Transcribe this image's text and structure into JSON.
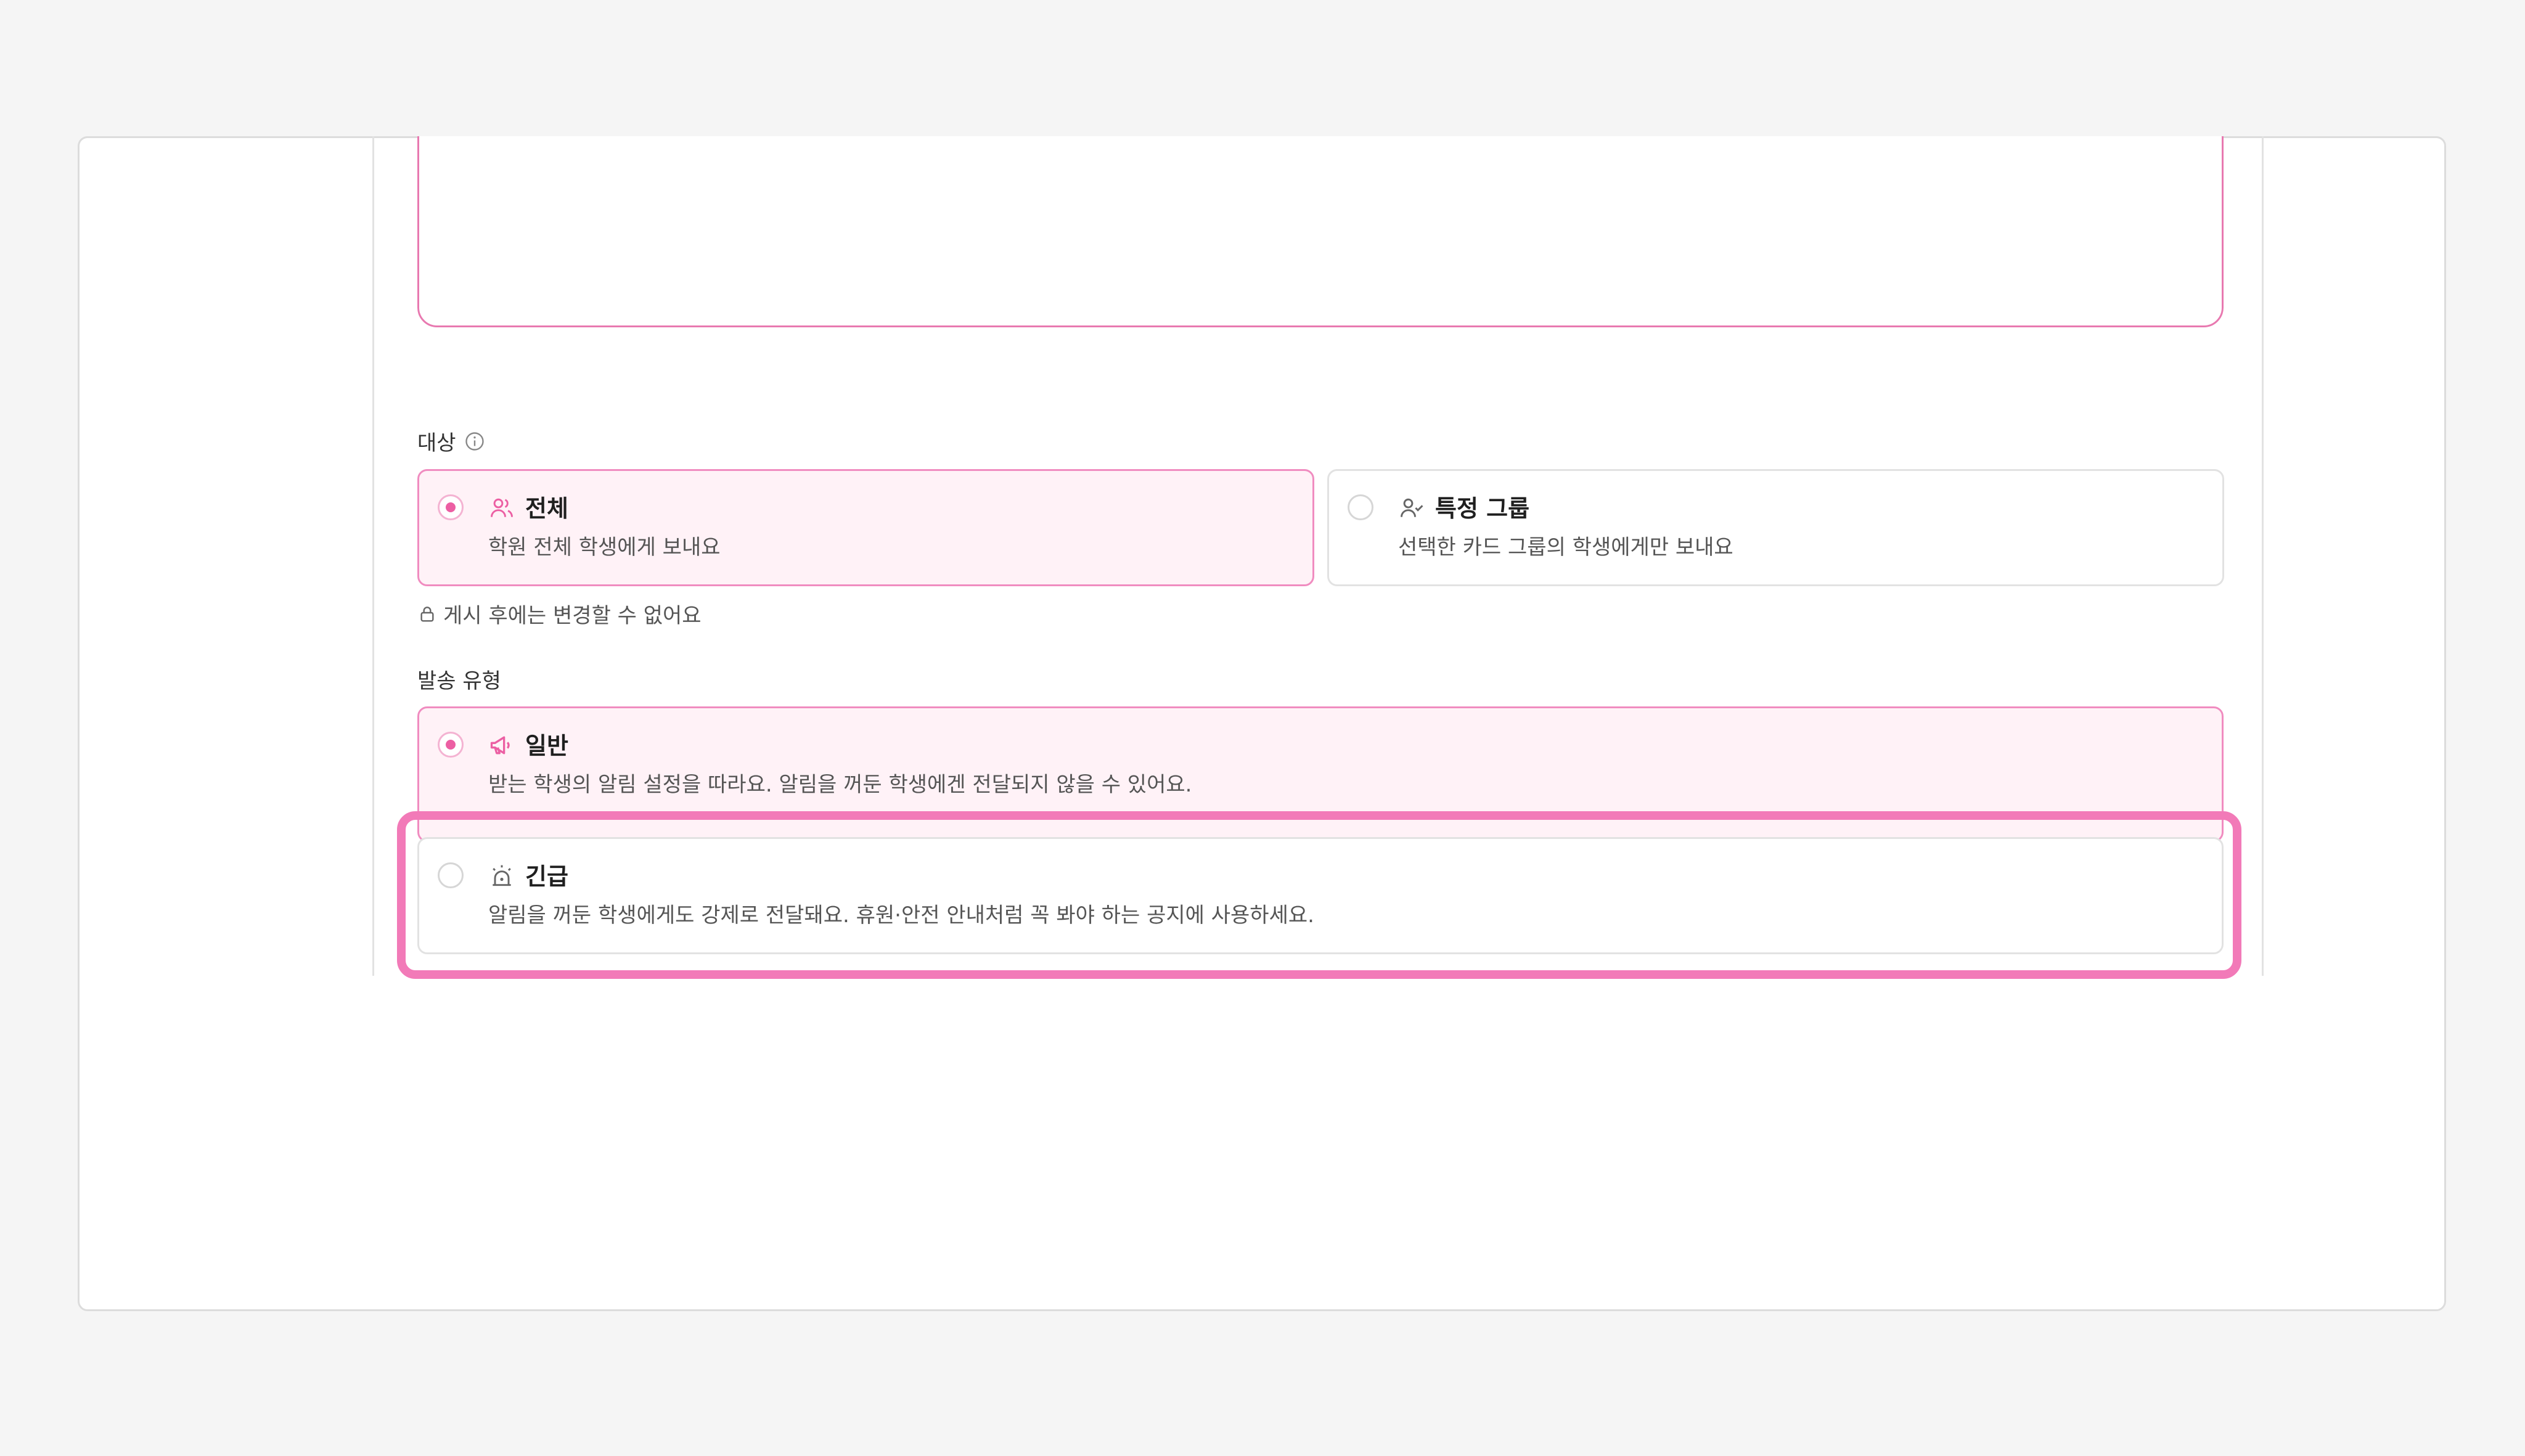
{
  "target": {
    "label": "대상",
    "options": [
      {
        "title": "전체",
        "desc": "학원 전체 학생에게 보내요",
        "selected": true,
        "icon": "users-icon"
      },
      {
        "title": "특정 그룹",
        "desc": "선택한 카드 그룹의 학생에게만 보내요",
        "selected": false,
        "icon": "user-check-icon"
      }
    ],
    "lock_note": "게시 후에는 변경할 수 없어요"
  },
  "send_type": {
    "label": "발송 유형",
    "options": [
      {
        "title": "일반",
        "desc": "받는 학생의 알림 설정을 따라요. 알림을 꺼둔 학생에겐 전달되지 않을 수 있어요.",
        "selected": true,
        "icon": "megaphone-icon"
      },
      {
        "title": "긴급",
        "desc": "알림을 꺼둔 학생에게도 강제로 전달돼요. 휴원·안전 안내처럼 꼭 봐야 하는 공지에 사용하세요.",
        "selected": false,
        "icon": "siren-icon"
      }
    ]
  },
  "colors": {
    "accent": "#ec5fa3",
    "selected_bg": "#fff2f7",
    "highlight": "#f27ab8"
  }
}
